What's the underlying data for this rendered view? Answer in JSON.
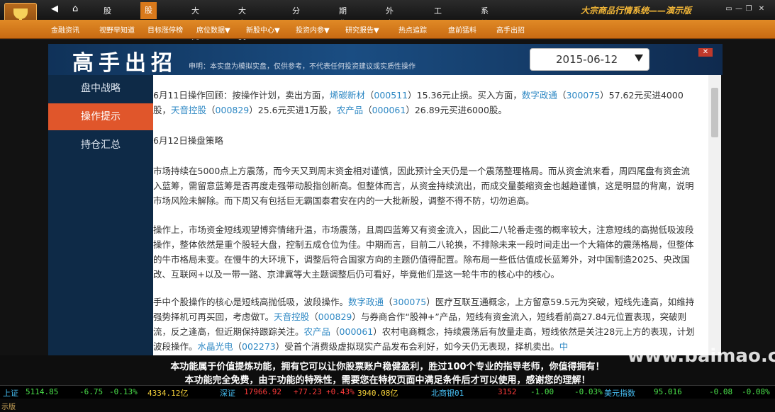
{
  "app": {
    "system_title": "大宗商品行情系统——演示版"
  },
  "menu": [
    "股票",
    "股票资讯",
    "大宗商品",
    "大宗资讯",
    "分析",
    "期货",
    "外盘",
    "工具",
    "系统"
  ],
  "submenu": [
    "金融资讯",
    "视野早知道",
    "目标涨停榜",
    "席位数据▼",
    "新股中心▼",
    "投资内参▼",
    "研究报告▼",
    "热点追踪",
    "盘前猛料",
    "高手出招"
  ],
  "header": {
    "title": "高手出招",
    "disclaimer": "申明：本实盘为模拟实盘，仅供参考，不代表任何投资建议或实质性操作",
    "date": "2015-06-12"
  },
  "sidebar": [
    {
      "label": "盘中战略"
    },
    {
      "label": "操作提示"
    },
    {
      "label": "持仓汇总"
    }
  ],
  "content": {
    "p1": [
      "6月11日操作回顾：按操作计划，卖出方面，",
      "烯碳新材",
      "（",
      "000511",
      "）15.36元止损。买入方面，",
      "数字政通",
      "（",
      "300075",
      "）57.62元买进4000股，",
      "天音控股",
      "（",
      "000829",
      "）25.6元买进1万股，",
      "农产品",
      "（",
      "000061",
      "）26.89元买进6000股。"
    ],
    "p2": "6月12日操盘策略",
    "p3": "市场持续在5000点上方震荡，而今天又到周末资金相对谨慎，因此预计全天仍是一个震荡整理格局。而从资金流来看，周四尾盘有资金流入蓝筹，需留意蓝筹是否再度走强带动股指创新高。但整体而言，从资金持续流出，而成交量萎缩资金也越趋谨慎，这是明显的背离，说明市场风险未解除。而下周又有包括巨无霸国泰君安在内的一大批新股，调整不得不防，切勿追高。",
    "p4": "操作上，市场资金短线观望博弈情绪升温，市场震荡，且周四蓝筹又有资金流入，因此二八轮番走强的概率较大，注意短线的高抛低吸波段操作，整体依然是重个股轻大盘，控制五成仓位为佳。中期而言，目前二八轮换，不排除未来一段时间走出一个大箱体的震荡格局，但整体的牛市格局未变。在慢牛的大环境下，调整后符合国家方向的主题仍值得配置。除布局一些低估值成长蓝筹外，对中国制造2025、央改国改、互联网+以及一带一路、京津冀等大主题调整后仍可看好，毕竟他们是这一轮牛市的核心中的核心。",
    "p5": [
      "手中个股操作的核心是短线高抛低吸，波段操作。",
      "数字政通",
      "（",
      "300075",
      "）医疗互联互通概念，上方留意59.5元为突破，短线先逢高，如维持强势择机可再买回，考虑做T。",
      "天音控股",
      "（",
      "000829",
      "）与券商合作“股神+”产品，短线有资金流入，短线看前高27.84元位置表现，突破则流，反之逢高，但近期保持跟踪关注。",
      "农产品",
      "（",
      "000061",
      "）农村电商概念，持续震荡后有放量走高，短线依然是关注28元上方的表现，计划波段操作。",
      "水晶光电",
      "（",
      "002273",
      "）受首个消费级虚拟现实产品发布会利好，如今天仍无表现，择机卖出。",
      "中"
    ]
  },
  "promo": {
    "line1": "本功能属于价值提炼功能，拥有它可以让你股票账户稳健盈利，胜过100个专业的指导老师，你值得拥有！",
    "line2": "本功能完全免费，由于功能的特殊性，需要您在特权页面中满足条件后才可以使用，感谢您的理解！"
  },
  "watermark": "www.baimao.com",
  "ticker": {
    "sh": {
      "name": "上证",
      "price": "5114.85",
      "chg": "-6.75",
      "pct": "-0.13%",
      "vol": "4334.12亿"
    },
    "sz": {
      "name": "深证",
      "price": "17966.92",
      "chg": "+77.23",
      "pct": "+0.43%",
      "vol": "3940.08亿"
    },
    "nb": {
      "name": "北商银01",
      "price": "3152",
      "chg": "-1.00",
      "pct": "-0.03%"
    },
    "usd": {
      "name": "美元指数",
      "price": "95.016",
      "chg": "-0.08",
      "pct": "-0.08%"
    }
  },
  "status": "示版"
}
